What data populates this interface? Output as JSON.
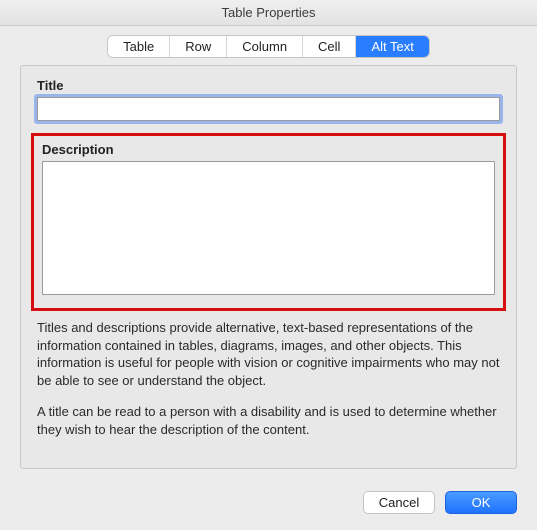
{
  "window": {
    "title": "Table Properties"
  },
  "tabs": {
    "items": [
      {
        "label": "Table",
        "active": false
      },
      {
        "label": "Row",
        "active": false
      },
      {
        "label": "Column",
        "active": false
      },
      {
        "label": "Cell",
        "active": false
      },
      {
        "label": "Alt Text",
        "active": true
      }
    ]
  },
  "fields": {
    "title_label": "Title",
    "title_value": "",
    "description_label": "Description",
    "description_value": ""
  },
  "help": {
    "para1": "Titles and descriptions provide alternative, text-based representations of the information contained in tables, diagrams, images, and other objects. This information is useful for people with vision or cognitive impairments who may not be able to see or understand the object.",
    "para2": "A title can be read to a person with a disability and is used to determine whether they wish to hear the description of the content."
  },
  "buttons": {
    "cancel": "Cancel",
    "ok": "OK"
  }
}
